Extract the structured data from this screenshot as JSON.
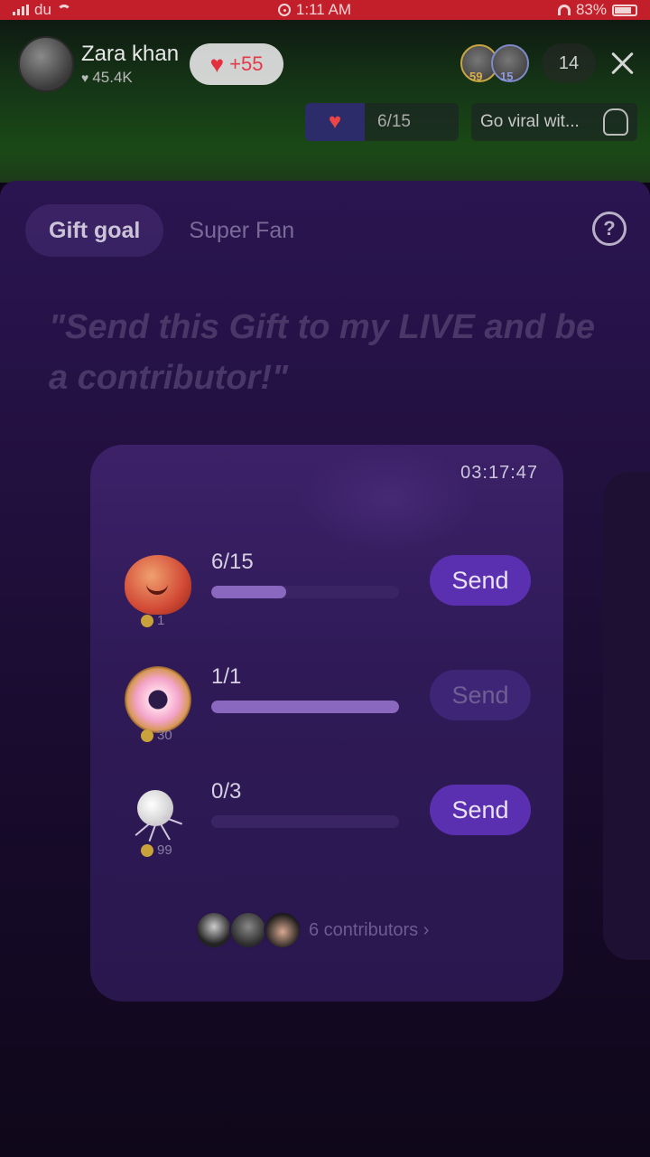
{
  "status_bar": {
    "carrier": "du",
    "time": "1:11 AM",
    "battery": "83%",
    "battery_fraction": 0.83
  },
  "host": {
    "name": "Zara khan",
    "likes": "45.4K",
    "plus_likes": "+55"
  },
  "viewers": {
    "badges": [
      "59",
      "15"
    ],
    "count": "14"
  },
  "live_pills": {
    "goal_progress": "6/15",
    "promo": "Go viral wit..."
  },
  "tabs": [
    "Gift goal",
    "Super Fan"
  ],
  "quote": "\"Send this Gift to my LIVE and be a contributor!\"",
  "card": {
    "timer": "03:17:47",
    "gifts": [
      {
        "coins": "1",
        "count": "6/15",
        "progress": 0.4,
        "send_label": "Send",
        "enabled": true
      },
      {
        "coins": "30",
        "count": "1/1",
        "progress": 1.0,
        "send_label": "Send",
        "enabled": false
      },
      {
        "coins": "99",
        "count": "0/3",
        "progress": 0.0,
        "send_label": "Send",
        "enabled": true
      }
    ],
    "contributors_label": "6 contributors ›"
  }
}
